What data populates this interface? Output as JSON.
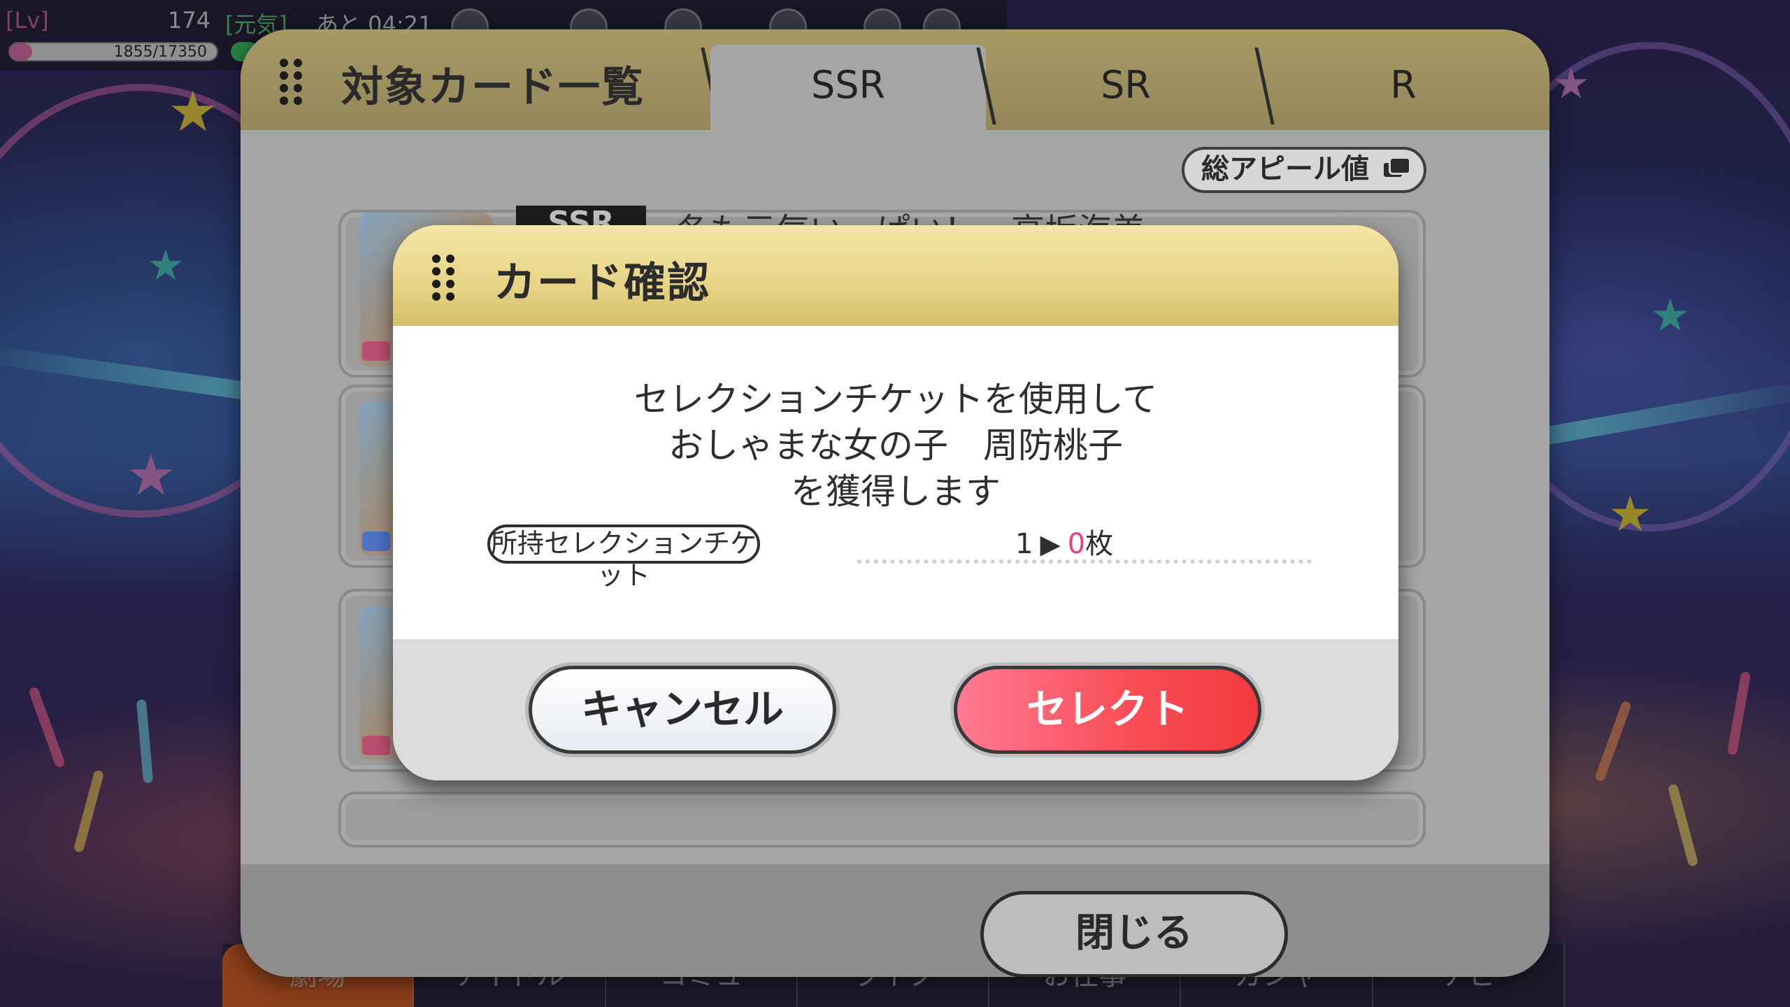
{
  "hud": {
    "lv_label": "[Lv]",
    "level": "174",
    "stamina_label": "[元気]",
    "time_label": "あと 04:21",
    "exp_text": "1855/17350",
    "exp_progress": 0.107
  },
  "list_panel": {
    "title": "対象カード一覧",
    "tabs": [
      {
        "label": "SSR",
        "active": true
      },
      {
        "label": "SR",
        "active": false
      },
      {
        "label": "R",
        "active": false
      }
    ],
    "sort_button_label": "総アピール値",
    "cards": [
      {
        "rarity": "SSR",
        "name": "冬も元気いっぱい！　高坂海美"
      },
      {
        "rarity": "",
        "name": ""
      },
      {
        "rarity": "",
        "name": ""
      }
    ],
    "close_label": "閉じる"
  },
  "dialog": {
    "title": "カード確認",
    "message_line1": "セレクションチケットを使用して",
    "message_line2": "おしゃまな女の子　周防桃子",
    "message_line3": "を獲得します",
    "ticket_label": "所持セレクションチケット",
    "ticket_before": "1",
    "ticket_arrow": "▶",
    "ticket_after": "0",
    "ticket_unit": "枚",
    "cancel_label": "キャンセル",
    "select_label": "セレクト"
  },
  "bottom_nav": [
    {
      "label": "劇場",
      "active": true
    },
    {
      "label": "アイドル",
      "active": false
    },
    {
      "label": "コミュ",
      "active": false
    },
    {
      "label": "ライブ",
      "active": false
    },
    {
      "label": "お仕事",
      "active": false
    },
    {
      "label": "ガシャ",
      "active": false
    },
    {
      "label": "ナビ",
      "active": false
    }
  ],
  "colors": {
    "list_header": "#a89a66",
    "dialog_header": "#e7d486",
    "select_button": "#f94f5a",
    "ticket_after": "#ef3b8c",
    "nav_active": "#e2672a"
  }
}
